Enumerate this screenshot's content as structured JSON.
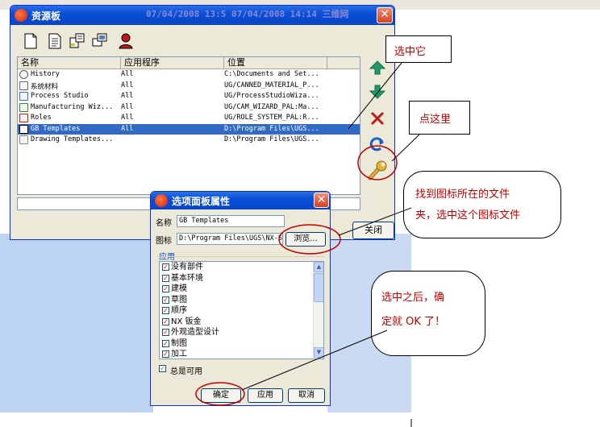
{
  "resource_window": {
    "title": "资源板",
    "overlay_dates": "07/04/2008  13:5 07/04/2008  14:14  三维网",
    "columns": [
      "名称",
      "应用程序",
      "位置"
    ],
    "rows": [
      {
        "name": "History",
        "app": "All",
        "location": "C:\\Documents and Set...",
        "icon": "history-icon",
        "selected": false
      },
      {
        "name": "系统材料",
        "app": "All",
        "location": "UG/CANNED_MATERIAL_P...",
        "icon": "material-icon",
        "selected": false
      },
      {
        "name": "Process Studio",
        "app": "All",
        "location": "UG/ProcessStudioWiza...",
        "icon": "process-studio-icon",
        "selected": false
      },
      {
        "name": "Manufacturing Wiz...",
        "app": "All",
        "location": "UG/CAM_WIZARD_PAL:Ma...",
        "icon": "manufacturing-icon",
        "selected": false
      },
      {
        "name": "Roles",
        "app": "All",
        "location": "UG/ROLE_SYSTEM_PAL:R...",
        "icon": "roles-icon",
        "selected": false
      },
      {
        "name": "GB Templates",
        "app": "All",
        "location": "D:\\Program Files\\UGS...",
        "icon": "gb-icon",
        "selected": true
      },
      {
        "name": "Drawing Templates...",
        "app": "",
        "location": "D:\\Program Files\\UGS...",
        "icon": "drawing-templates-icon",
        "selected": false
      }
    ],
    "close_label": "关闭"
  },
  "options_dialog": {
    "title": "选项面板属性",
    "name_label": "名称",
    "name_value": "GB Templates",
    "icon_label": "图标",
    "icon_value": "D:\\Program Files\\UGS\\NX-S",
    "browse_label": "浏览...",
    "group_label": "应用",
    "apps": [
      "没有部件",
      "基本环境",
      "建模",
      "草图",
      "顺序",
      "NX 钣金",
      "外观造型设计",
      "制图",
      "加工"
    ],
    "always_label": "总是可用",
    "ok_label": "确定",
    "apply_label": "应用",
    "cancel_label": "取消"
  },
  "callouts": {
    "select_it": "选中它",
    "click_here": "点这里",
    "find_icon_line1": "找到图标所在的文件",
    "find_icon_line2": "夹，选中这个图标文件",
    "after_select_line1": "选中之后，确",
    "after_select_line2": "定就 OK 了！"
  },
  "colors": {
    "accent_red": "#c00000",
    "title_blue": "#0a4fd6",
    "selection": "#316ac5"
  }
}
